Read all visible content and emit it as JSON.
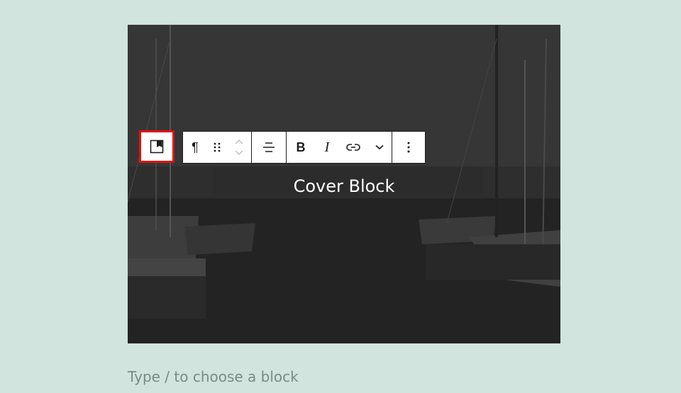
{
  "cover": {
    "title": "Cover Block"
  },
  "toolbar": {
    "parent_select_icon": "cover-block-icon",
    "buttons": [
      {
        "name": "paragraph-transform",
        "icon": "pilcrow",
        "glyph": "¶"
      },
      {
        "name": "drag-handle",
        "icon": "drag-handle-icon"
      },
      {
        "name": "move-up-down",
        "icon": "chevron-up-down-icon"
      },
      {
        "name": "align",
        "icon": "align-center-icon"
      },
      {
        "name": "bold",
        "glyph": "B"
      },
      {
        "name": "italic",
        "glyph": "I"
      },
      {
        "name": "link",
        "icon": "link-icon"
      },
      {
        "name": "more-formatting",
        "icon": "chevron-down-icon"
      },
      {
        "name": "options",
        "icon": "more-vertical-icon"
      }
    ]
  },
  "appender": {
    "placeholder": "Type / to choose a block"
  },
  "colors": {
    "background": "#d1e4dd",
    "highlight": "#e01010",
    "toolbar_border": "#1e1e1e"
  }
}
